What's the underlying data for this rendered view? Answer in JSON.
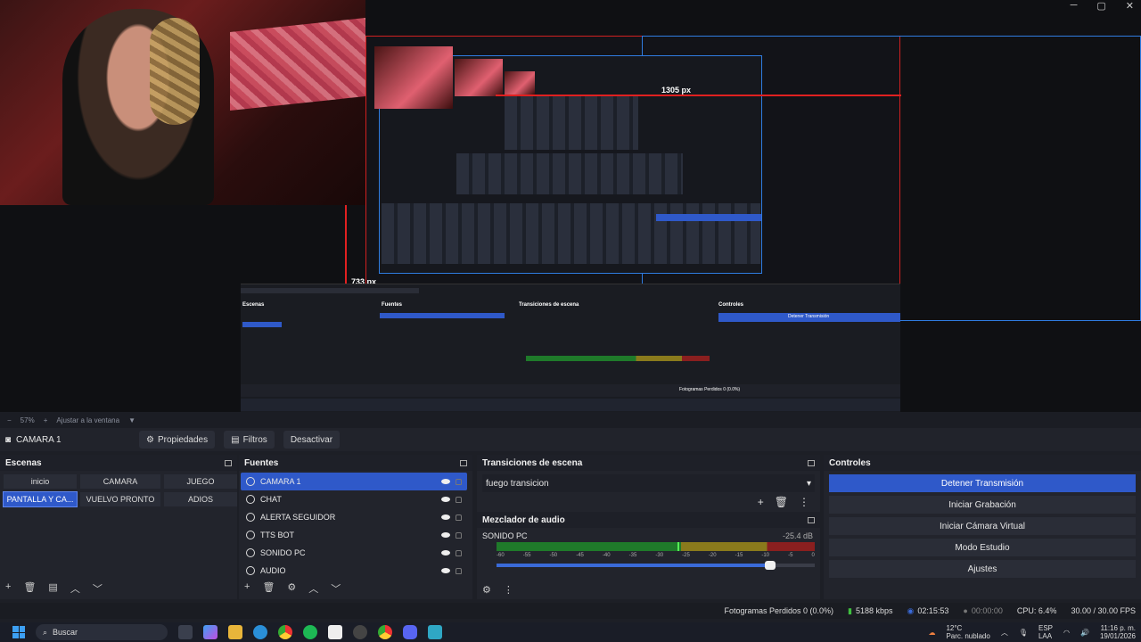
{
  "preview": {
    "label_1305": "1305 px",
    "label_733": "733 px",
    "mini_scenes_title": "Escenas",
    "mini_sources_title": "Fuentes",
    "mini_trans_title": "Transiciones de escena",
    "mini_controls_title": "Controles",
    "mini_stop": "Detener Transmisión",
    "mini_status": "Fotogramas Perdidos 0 (0.0%)"
  },
  "zoom": {
    "value": "57%",
    "fit_label": "Ajustar a la ventana"
  },
  "source_toolbar": {
    "current_source": "CAMARA 1",
    "properties": "Propiedades",
    "filters": "Filtros",
    "deactivate": "Desactivar"
  },
  "scenes": {
    "title": "Escenas",
    "items": [
      {
        "label": "inicio",
        "active": false
      },
      {
        "label": "CAMARA",
        "active": false
      },
      {
        "label": "JUEGO",
        "active": false
      },
      {
        "label": "PANTALLA Y CA...",
        "active": true
      },
      {
        "label": "VUELVO PRONTO",
        "active": false
      },
      {
        "label": "ADIOS",
        "active": false
      }
    ]
  },
  "sources": {
    "title": "Fuentes",
    "items": [
      {
        "label": "CAMARA 1",
        "selected": true
      },
      {
        "label": "CHAT",
        "selected": false
      },
      {
        "label": "ALERTA SEGUIDOR",
        "selected": false
      },
      {
        "label": "TTS BOT",
        "selected": false
      },
      {
        "label": "SONIDO PC",
        "selected": false
      },
      {
        "label": "AUDIO",
        "selected": false
      }
    ]
  },
  "transitions": {
    "title": "Transiciones de escena",
    "selected": "fuego transicion"
  },
  "mixer": {
    "title": "Mezclador de audio",
    "channel": "SONIDO PC",
    "db": "-25.4 dB",
    "ticks": [
      "-60",
      "-55",
      "-50",
      "-45",
      "-40",
      "-35",
      "-30",
      "-25",
      "-20",
      "-15",
      "-10",
      "-5",
      "0"
    ],
    "volume_level": 0.86,
    "peak_level": 0.57
  },
  "controls": {
    "title": "Controles",
    "stop_stream": "Detener Transmisión",
    "start_recording": "Iniciar Grabación",
    "start_virtual_cam": "Iniciar Cámara Virtual",
    "studio_mode": "Modo Estudio",
    "settings": "Ajustes"
  },
  "status": {
    "dropped_frames": "Fotogramas Perdidos 0 (0.0%)",
    "bitrate": "5188 kbps",
    "stream_time": "02:15:53",
    "record_time": "00:00:00",
    "cpu": "CPU: 6.4%",
    "fps": "30.00 / 30.00 FPS"
  },
  "taskbar": {
    "search": "Buscar",
    "weather_temp": "12°C",
    "weather_desc": "Parc. nublado",
    "lang": "ESP",
    "layout": "LAA",
    "time": "11:16 p. m.",
    "date": "19/01/2026"
  },
  "colors": {
    "accent": "#2f59c9",
    "meter_green": "#1f7a2a",
    "meter_yellow": "#8a7a1c",
    "meter_red": "#8a1f1f"
  }
}
